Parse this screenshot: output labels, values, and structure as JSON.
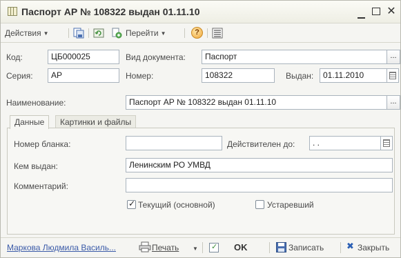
{
  "window": {
    "title": "Паспорт АР № 108322 выдан 01.11.10",
    "minimize_icon": "minimize-icon",
    "maximize_icon": "maximize-icon",
    "close_glyph": "✕"
  },
  "toolbar": {
    "actions_label": "Действия",
    "goto_label": "Перейти",
    "help_glyph": "?",
    "icons": [
      "save-copy-icon",
      "refresh-icon",
      "copy-document-icon",
      "help-icon",
      "structure-icon"
    ]
  },
  "form": {
    "code_label": "Код:",
    "code_value": "ЦБ000025",
    "doc_type_label": "Вид документа:",
    "doc_type_value": "Паспорт",
    "series_label": "Серия:",
    "series_value": "АР",
    "number_label": "Номер:",
    "number_value": "108322",
    "issued_label": "Выдан:",
    "issued_value": "01.11.2010",
    "name_label": "Наименование:",
    "name_value": "Паспорт АР № 108322 выдан 01.11.10",
    "select_glyph": "..."
  },
  "tabs": {
    "data_label": "Данные",
    "images_label": "Картинки и файлы"
  },
  "data_tab": {
    "blank_number_label": "Номер бланка:",
    "blank_number_value": "",
    "valid_until_label": "Действителен до:",
    "valid_until_value": " .  .",
    "issued_by_label": "Кем выдан:",
    "issued_by_value": "Ленинским РО УМВД",
    "comment_label": "Комментарий:",
    "comment_value": "",
    "current_label": "Текущий (основной)",
    "current_checked": true,
    "outdated_label": "Устаревший",
    "outdated_checked": false
  },
  "bottom": {
    "user_link": "Маркова Людмила Василь...",
    "print_label": "Печать",
    "ok_label": "OK",
    "save_label": "Записать",
    "close_label": "Закрыть"
  },
  "colors": {
    "link": "#3a5aa8",
    "close_x": "#2b5fb4",
    "save_icon": "#4a6fb0",
    "refresh_icon": "#3e8e3a"
  }
}
